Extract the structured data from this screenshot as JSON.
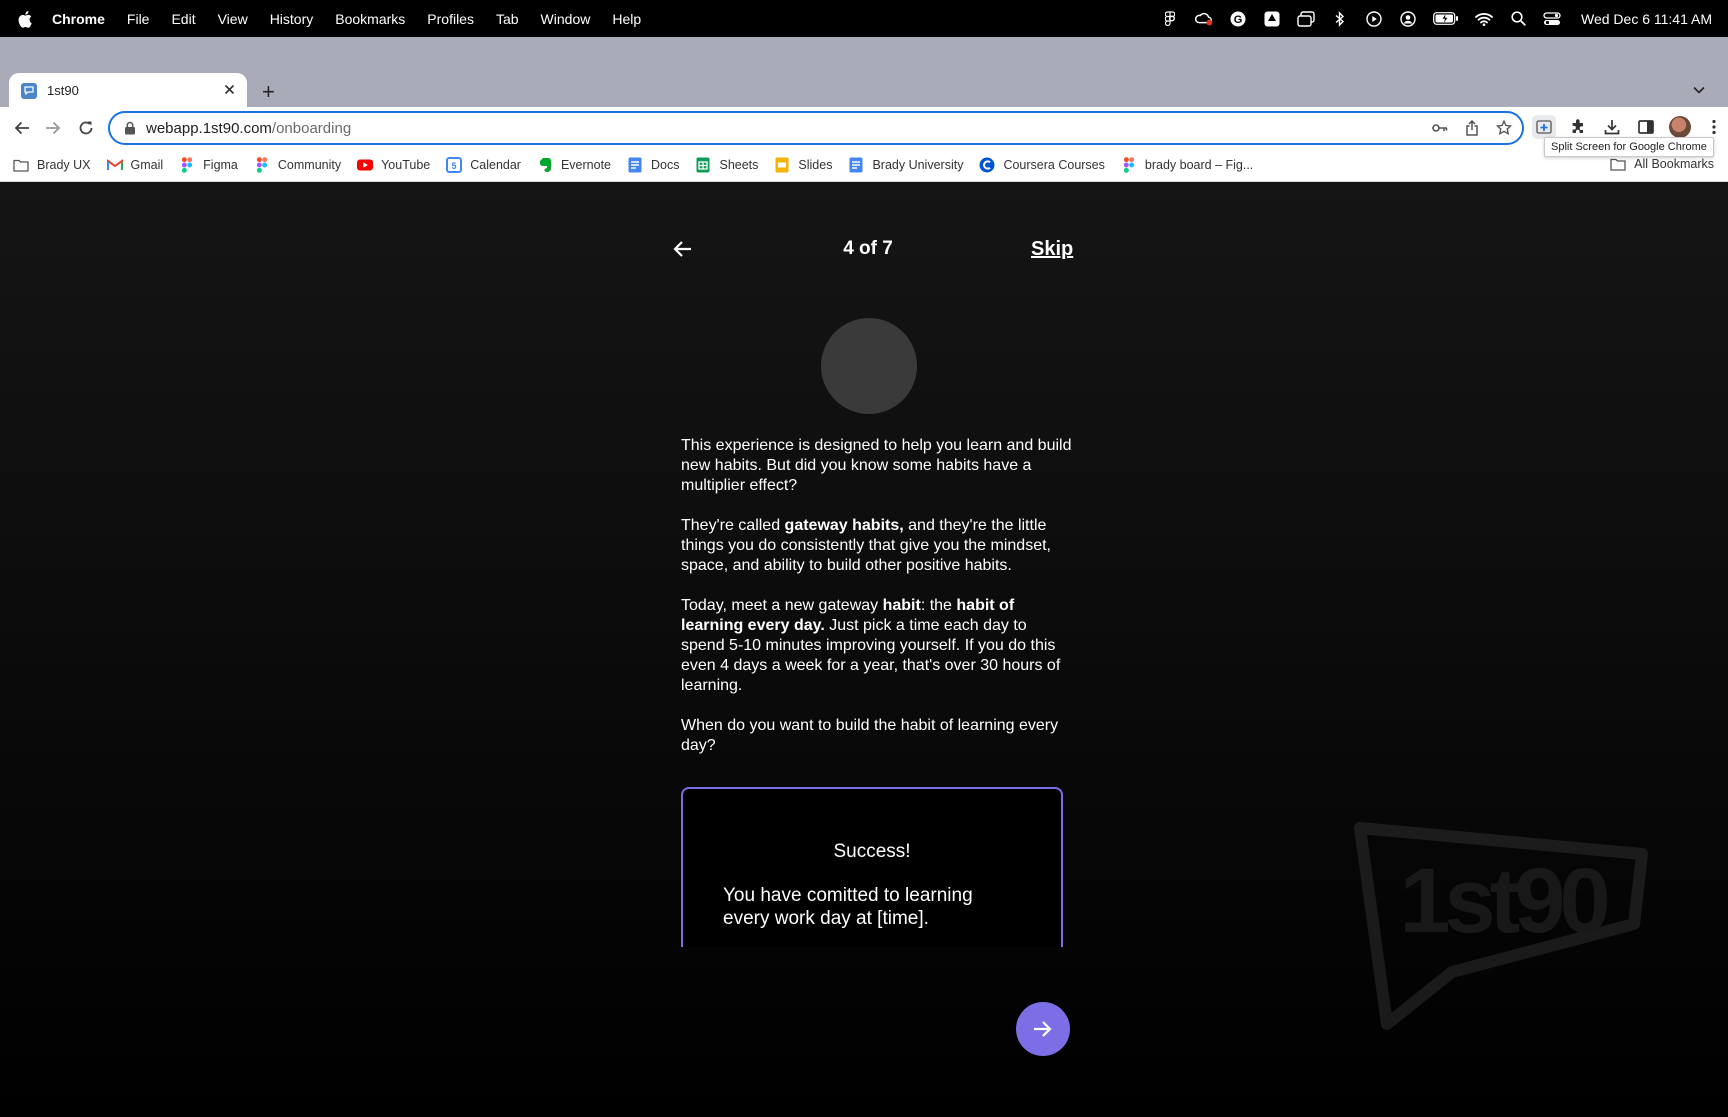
{
  "menubar": {
    "app": "Chrome",
    "items": [
      "File",
      "Edit",
      "View",
      "History",
      "Bookmarks",
      "Profiles",
      "Tab",
      "Window",
      "Help"
    ],
    "clock": "Wed Dec 6  11:41 AM"
  },
  "tab": {
    "title": "1st90",
    "new_tab": "+"
  },
  "omnibox": {
    "host": "webapp.1st90.com",
    "path": "/onboarding"
  },
  "tooltip": "Split Screen for Google Chrome",
  "bookmarks": {
    "items": [
      "Brady UX",
      "Gmail",
      "Figma",
      "Community",
      "YouTube",
      "Calendar",
      "Evernote",
      "Docs",
      "Sheets",
      "Slides",
      "Brady University",
      "Coursera Courses",
      "brady board – Fig..."
    ],
    "all": "All Bookmarks"
  },
  "onboarding": {
    "progress": "4 of 7",
    "skip": "Skip",
    "p1": "This experience is designed to help you learn and build new habits. But did you know some habits have a multiplier effect?",
    "p2_a": "They're called ",
    "p2_b": "gateway habits,",
    "p2_c": " and they're the little things you do consistently that give you the mindset, space, and ability to build other positive habits.",
    "p3_a": "Today, meet a new gateway ",
    "p3_b": "habit",
    "p3_c": ": the ",
    "p3_d": "habit of learning every day.",
    "p3_e": " Just pick a time each day to spend 5-10 minutes improving yourself. If you do this even 4 days a week for a year, that's over 30 hours of learning.",
    "p4": "When do you want to build the habit of learning every day?",
    "card_title": "Success!",
    "card_body": "You have comitted to learning every work day at [time]."
  },
  "watermark": "1st90",
  "colors": {
    "accent": "#7c6fe6",
    "omnibox_border": "#1a73e8"
  }
}
